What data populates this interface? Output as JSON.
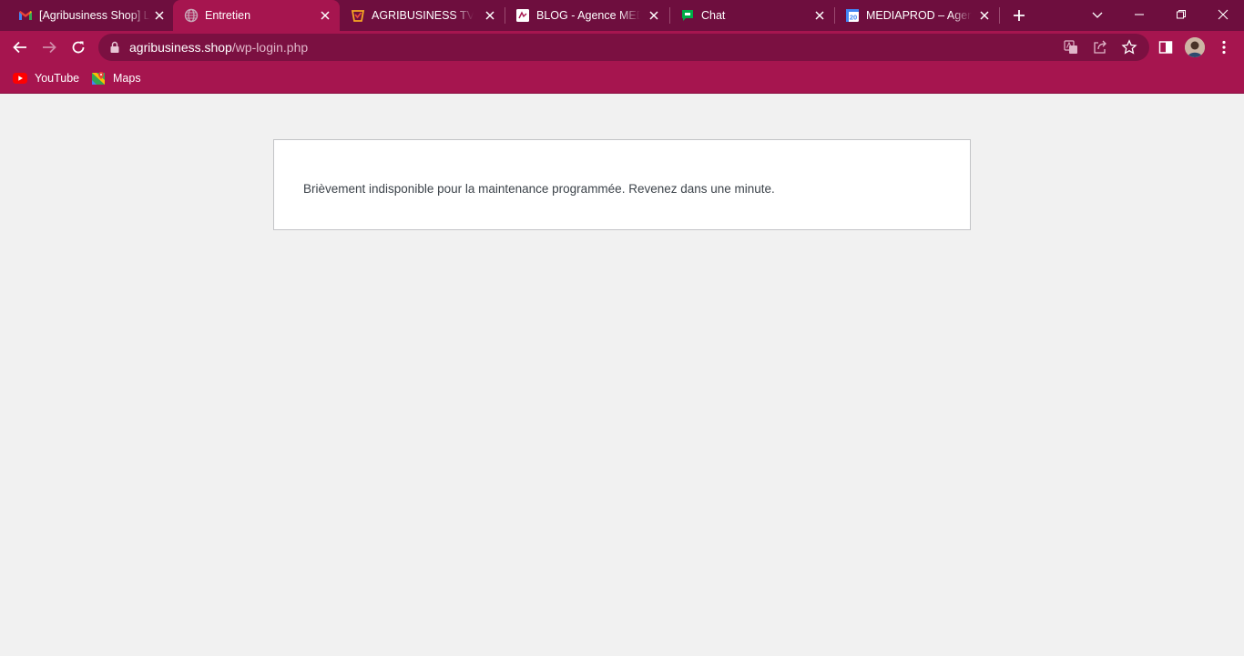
{
  "browser": {
    "tabs": [
      {
        "title": "[Agribusiness Shop] L",
        "icon": "gmail-icon",
        "active": false
      },
      {
        "title": "Entretien",
        "icon": "globe-icon",
        "active": true
      },
      {
        "title": "AGRIBUSINESS TV – V",
        "icon": "agribusiness-tv-icon",
        "active": false
      },
      {
        "title": "BLOG - Agence MEDI",
        "icon": "blog-icon",
        "active": false
      },
      {
        "title": "Chat",
        "icon": "google-chat-icon",
        "active": false
      },
      {
        "title": "MEDIAPROD – Agenc",
        "icon": "calendar-icon",
        "active": false
      }
    ],
    "calendar_day": "20",
    "address": {
      "host": "agribusiness.shop",
      "path": "/wp-login.php"
    },
    "bookmarks": [
      {
        "label": "YouTube",
        "icon": "youtube-icon"
      },
      {
        "label": "Maps",
        "icon": "maps-icon"
      }
    ],
    "colors": {
      "frame": "#6e0e3e",
      "toolbar": "#a6154f",
      "omnibox": "#7b1041"
    }
  },
  "page": {
    "message": "Brièvement indisponible pour la maintenance programmée. Revenez dans une minute."
  }
}
